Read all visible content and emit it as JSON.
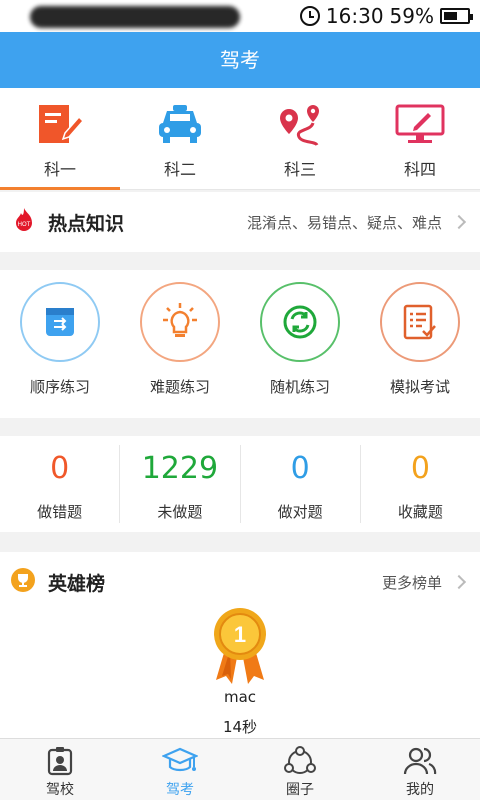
{
  "status_bar": {
    "time": "16:30",
    "battery": "59%",
    "battery_level": 0.59
  },
  "title": "驾考",
  "subject_tabs": [
    {
      "label": "科一",
      "icon": "document-edit-icon",
      "active": true
    },
    {
      "label": "科二",
      "icon": "car-icon",
      "active": false
    },
    {
      "label": "科三",
      "icon": "route-pin-icon",
      "active": false
    },
    {
      "label": "科四",
      "icon": "monitor-pen-icon",
      "active": false
    }
  ],
  "hot_knowledge": {
    "title": "热点知识",
    "subtitle": "混淆点、易错点、疑点、难点",
    "badge": "HOT"
  },
  "practice": [
    {
      "label": "顺序练习",
      "icon": "sequence-icon",
      "color": "#3ea2ef"
    },
    {
      "label": "难题练习",
      "icon": "lightbulb-icon",
      "color": "#f3802f"
    },
    {
      "label": "随机练习",
      "icon": "shuffle-icon",
      "color": "#22a83a"
    },
    {
      "label": "模拟考试",
      "icon": "exam-checklist-icon",
      "color": "#e0602c"
    }
  ],
  "stats": [
    {
      "value": "0",
      "label": "做错题",
      "color": "#f0582a"
    },
    {
      "value": "1229",
      "label": "未做题",
      "color": "#1fa83a"
    },
    {
      "value": "0",
      "label": "做对题",
      "color": "#2f9de6"
    },
    {
      "value": "0",
      "label": "收藏题",
      "color": "#f3a21d"
    }
  ],
  "hero": {
    "title": "英雄榜",
    "more": "更多榜单",
    "user": "mac",
    "time": "14秒",
    "medal_number": "1"
  },
  "bottom_nav": [
    {
      "label": "驾校",
      "icon": "badge-person-icon",
      "active": false
    },
    {
      "label": "驾考",
      "icon": "graduation-cap-icon",
      "active": true
    },
    {
      "label": "圈子",
      "icon": "share-circle-icon",
      "active": false
    },
    {
      "label": "我的",
      "icon": "users-icon",
      "active": false
    }
  ]
}
